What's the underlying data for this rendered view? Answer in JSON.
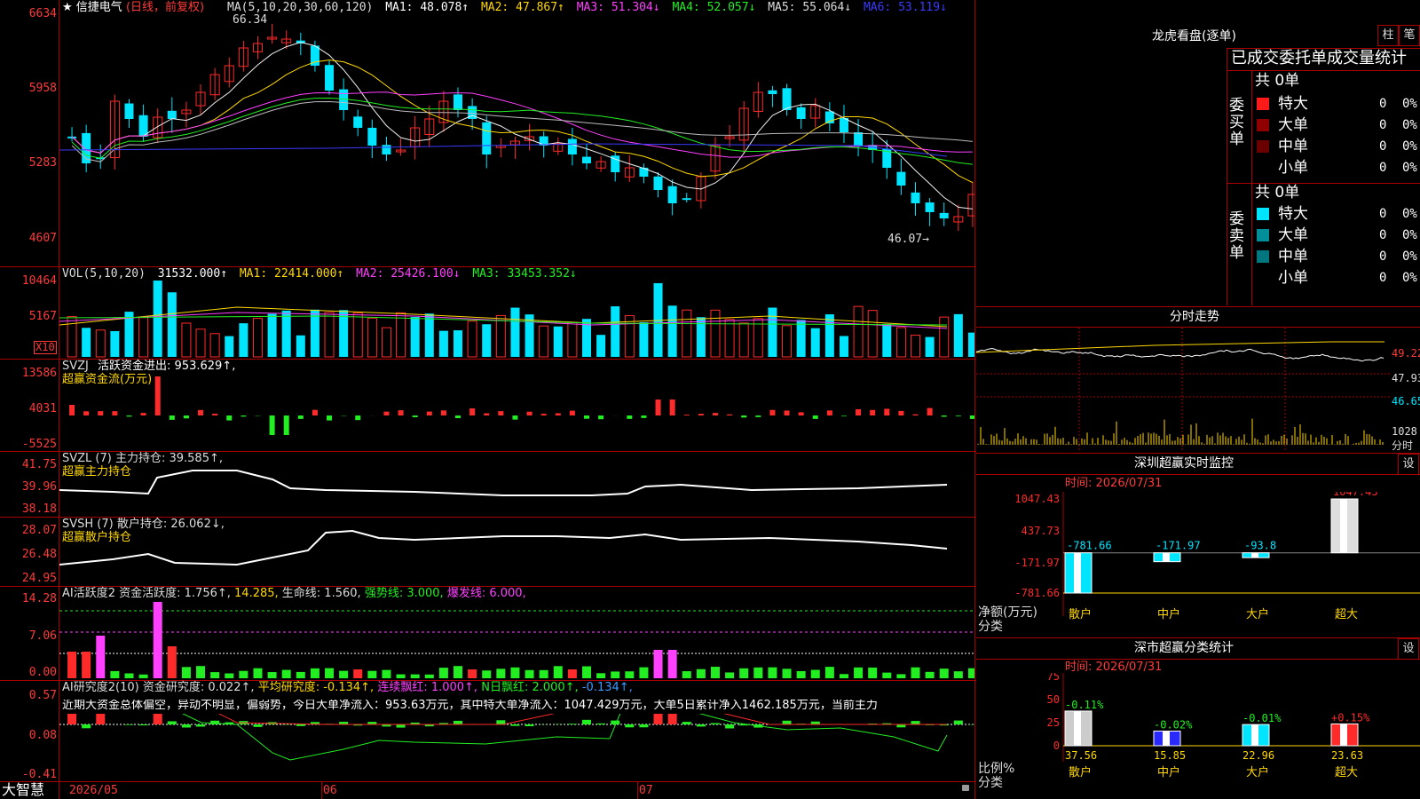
{
  "colors": {
    "up": "#ff2a2a",
    "down": "#00e5ff",
    "grid": "#aa0000",
    "yellow": "#ffd800",
    "magenta": "#ff40ff",
    "green": "#22ee22",
    "blue": "#3a3aff",
    "white": "#f0f0f0",
    "orange": "#ff8a3a"
  },
  "header": {
    "star_icon": "star-icon",
    "stock_name": "信捷电气",
    "period": "(日线，前复权)",
    "ma_label": "MA(5,10,20,30,60,120)",
    "ma_values": [
      "MA1: 48.078↑",
      "MA2: 47.867↑",
      "MA3: 51.304↓",
      "MA4: 52.057↓",
      "MA5: 55.064↓",
      "MA6: 53.119↓"
    ],
    "high_marker": "66.34",
    "low_marker": "46.07→"
  },
  "price_axis": [
    "6634",
    "5958",
    "5283",
    "4607"
  ],
  "vol_panel": {
    "header": [
      "VOL(5,10,20)",
      "31532.000↑",
      "MA1: 22414.000↑",
      "MA2: 25426.100↓",
      "MA3: 33453.352↓"
    ],
    "axis": [
      "10464",
      "5167"
    ],
    "unit": "X10"
  },
  "svzj_panel": {
    "header": [
      "SVZJ",
      "活跃资金进出: 953.629↑,"
    ],
    "sub": "超赢资金流(万元)",
    "axis": [
      "13586",
      "4031",
      "-5525"
    ]
  },
  "svzl_panel": {
    "header": [
      "SVZL (7) 主力持仓: 39.585↑,"
    ],
    "sub": "超赢主力持仓",
    "axis": [
      "41.75",
      "39.96",
      "38.18"
    ]
  },
  "svsh_panel": {
    "header": [
      "SVSH (7) 散户持仓: 26.062↓,"
    ],
    "sub": "超赢散户持仓",
    "axis": [
      "28.07",
      "26.48",
      "24.95"
    ]
  },
  "active_panel": {
    "header": [
      "AI活跃度2 资金活跃度: 1.756↑,",
      "14.285,",
      "生命线: 1.560,",
      "强势线: 3.000,",
      "爆发线: 6.000,"
    ],
    "axis": [
      "14.28",
      "7.06",
      "0.00"
    ]
  },
  "research_panel": {
    "header": [
      "AI研究度2(10) 资金研究度: 0.022↑,",
      "平均研究度: -0.134↑,",
      "连续飘红: 1.000↑,",
      "N日飘红: 2.000↑,",
      "-0.134↑,"
    ],
    "commentary": "近期大资金总体偏空，异动不明显，偏弱势，今日大单净流入：953.63万元，其中特大单净流入：1047.429万元，大单5日累计净入1462.185万元，当前主力",
    "axis": [
      "0.57",
      "0.08",
      "-0.41"
    ]
  },
  "date_axis": [
    "2026/05",
    "06",
    "07"
  ],
  "bottom_left": "大智慧",
  "right_top": {
    "title": "龙虎看盘(逐单)",
    "tab1": "柱",
    "tab2": "笔",
    "subtitle": "已成交委托单成交量统计",
    "buy_label": "委买单",
    "sell_label": "委卖单",
    "buy_total": "共 0单",
    "sell_total": "共 0单",
    "rows": [
      {
        "name": "特大",
        "value": "0",
        "pct": "0%"
      },
      {
        "name": "大单",
        "value": "0",
        "pct": "0%"
      },
      {
        "name": "中单",
        "value": "0",
        "pct": "0%"
      },
      {
        "name": "小单",
        "value": "0",
        "pct": "0%"
      }
    ]
  },
  "intraday": {
    "title": "分时走势",
    "axis": [
      "49.22",
      "47.93",
      "46.65"
    ],
    "vol_axis": [
      "1028",
      "分时"
    ]
  },
  "sz_monitor": {
    "title": "深圳超赢实时监控",
    "settings": "设",
    "date": "时间: 2026/07/31",
    "axis": [
      "1047.43",
      "437.73",
      "-171.97",
      "-781.66"
    ],
    "unit_label": [
      "净额(万元)",
      "分类"
    ],
    "bars": [
      {
        "name": "散户",
        "value": -781.66,
        "label": "-781.66"
      },
      {
        "name": "中户",
        "value": -171.97,
        "label": "-171.97"
      },
      {
        "name": "大户",
        "value": -93.8,
        "label": "-93.8"
      },
      {
        "name": "超大",
        "value": 1047.43,
        "label": "1047.43"
      }
    ]
  },
  "sz_class": {
    "title": "深市超赢分类统计",
    "settings": "设",
    "date": "时间: 2026/07/31",
    "axis": [
      "75",
      "50",
      "25",
      "0"
    ],
    "unit_label": [
      "比例%",
      "分类"
    ],
    "bars": [
      {
        "name": "散户",
        "value": 37.56,
        "change": "-0.11%"
      },
      {
        "name": "中户",
        "value": 15.85,
        "change": "-0.02%"
      },
      {
        "name": "大户",
        "value": 22.96,
        "change": "-0.01%"
      },
      {
        "name": "超大",
        "value": 23.63,
        "change": "+0.15%"
      }
    ]
  },
  "chart_data": {
    "type": "bar",
    "categories": [
      "散户",
      "中户",
      "大户",
      "超大"
    ],
    "series": [
      {
        "name": "净额(万元)",
        "values": [
          -781.66,
          -171.97,
          -93.8,
          1047.43
        ]
      },
      {
        "name": "比例%",
        "values": [
          37.56,
          15.85,
          22.96,
          23.63
        ]
      }
    ],
    "ylim": [
      -781.66,
      1047.43
    ]
  }
}
